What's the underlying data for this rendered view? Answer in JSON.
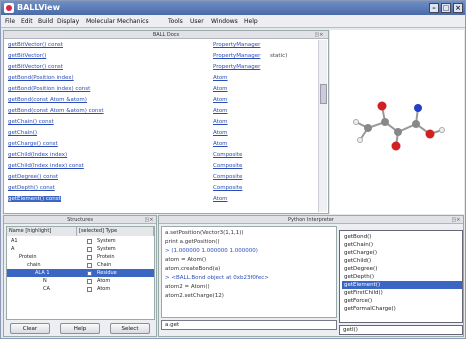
{
  "window": {
    "title": "BALLView"
  },
  "menu": [
    "File",
    "Edit",
    "Build",
    "Display",
    "Molecular Mechanics",
    "Tools",
    "User",
    "Windows",
    "Help"
  ],
  "docs": {
    "title": "BALL Docs",
    "rows": [
      {
        "left": "getBitVector() const",
        "right": "PropertyManager",
        "extra": ""
      },
      {
        "left": "getBitVector()",
        "right": "PropertyManager",
        "extra": "static)"
      },
      {
        "left": "getBitVector() const",
        "right": "PropertyManager",
        "extra": ""
      },
      {
        "left": "getBond(Position index)",
        "right": "Atom",
        "extra": ""
      },
      {
        "left": "getBond(Position index) const",
        "right": "Atom",
        "extra": ""
      },
      {
        "left": "getBond(const Atom &atom)",
        "right": "Atom",
        "extra": ""
      },
      {
        "left": "getBond(const Atom &atom) const",
        "right": "Atom",
        "extra": ""
      },
      {
        "left": "getChain() const",
        "right": "Atom",
        "extra": ""
      },
      {
        "left": "getChain()",
        "right": "Atom",
        "extra": ""
      },
      {
        "left": "getCharge() const",
        "right": "Atom",
        "extra": ""
      },
      {
        "left": "getChild(Index index)",
        "right": "Composite",
        "extra": ""
      },
      {
        "left": "getChild(Index index) const",
        "right": "Composite",
        "extra": ""
      },
      {
        "left": "getDegree() const",
        "right": "Composite",
        "extra": ""
      },
      {
        "left": "getDepth() const",
        "right": "Composite",
        "extra": ""
      },
      {
        "left": "getElement() const",
        "right": "Atom",
        "extra": ""
      }
    ]
  },
  "structures": {
    "title": "Structures",
    "headers": [
      "Name [highlight]",
      "[selected] Type"
    ],
    "rows": [
      {
        "name": "A1",
        "type": "System"
      },
      {
        "name": "A",
        "type": "System"
      },
      {
        "name": "Protein",
        "type": "Protein"
      },
      {
        "name": "chain",
        "type": "Chain"
      },
      {
        "name": "ALA 1",
        "type": "Residue"
      },
      {
        "name": "N",
        "type": "Atom"
      },
      {
        "name": "CA",
        "type": "Atom"
      }
    ],
    "buttons": [
      "Clear",
      "Help",
      "Select"
    ]
  },
  "python": {
    "title": "Python Interpreter",
    "lines": [
      "a.setPosition(Vector3(1,1,1))",
      "print a.getPosition()",
      "> (1.000000 1.000000 1.000000)",
      "atom = Atom()",
      "atom.createBond(a)",
      "> <BALL.Bond object at 0xb23f0fec>",
      "atom2 = Atom()",
      "atom2.setCharge(12)"
    ],
    "input": "a.get"
  },
  "completions": [
    "getBond()",
    "getChain()",
    "getCharge()",
    "getChild()",
    "getDegree()",
    "getDepth()",
    "getElement()",
    "getFirstChild()",
    "getForce()",
    "getFormalCharge()"
  ],
  "completion_last": "getI()",
  "colors": {
    "titlebar": "#5a7ab8",
    "selection": "#3b66c4",
    "link": "#2a4cb8"
  }
}
